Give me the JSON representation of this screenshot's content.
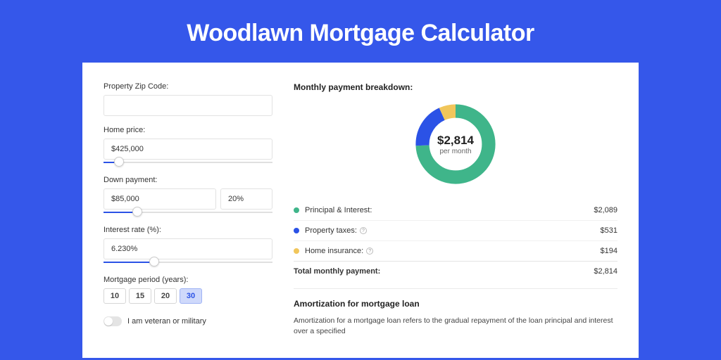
{
  "title": "Woodlawn Mortgage Calculator",
  "form": {
    "zip": {
      "label": "Property Zip Code:",
      "value": ""
    },
    "home_price": {
      "label": "Home price:",
      "value": "$425,000",
      "slider_pct": 9
    },
    "down_payment": {
      "label": "Down payment:",
      "amount": "$85,000",
      "pct": "20%",
      "slider_pct": 20
    },
    "interest": {
      "label": "Interest rate (%):",
      "value": "6.230%",
      "slider_pct": 30
    },
    "period": {
      "label": "Mortgage period (years):",
      "options": [
        "10",
        "15",
        "20",
        "30"
      ],
      "active": "30"
    },
    "veteran": {
      "label": "I am veteran or military",
      "on": false
    }
  },
  "breakdown": {
    "title": "Monthly payment breakdown:",
    "center_amount": "$2,814",
    "center_sub": "per month",
    "rows": [
      {
        "key": "principal",
        "label": "Principal & Interest:",
        "value": "$2,089",
        "info": false,
        "color": "green"
      },
      {
        "key": "taxes",
        "label": "Property taxes:",
        "value": "$531",
        "info": true,
        "color": "blue"
      },
      {
        "key": "insurance",
        "label": "Home insurance:",
        "value": "$194",
        "info": true,
        "color": "yellow"
      }
    ],
    "total": {
      "label": "Total monthly payment:",
      "value": "$2,814"
    }
  },
  "amortization": {
    "title": "Amortization for mortgage loan",
    "text": "Amortization for a mortgage loan refers to the gradual repayment of the loan principal and interest over a specified"
  },
  "chart_data": {
    "type": "pie",
    "title": "Monthly payment breakdown",
    "series": [
      {
        "name": "Principal & Interest",
        "value": 2089,
        "color": "#3fb58a"
      },
      {
        "name": "Property taxes",
        "value": 531,
        "color": "#2b52e6"
      },
      {
        "name": "Home insurance",
        "value": 194,
        "color": "#f1c65b"
      }
    ],
    "total": 2814,
    "donut": true
  }
}
